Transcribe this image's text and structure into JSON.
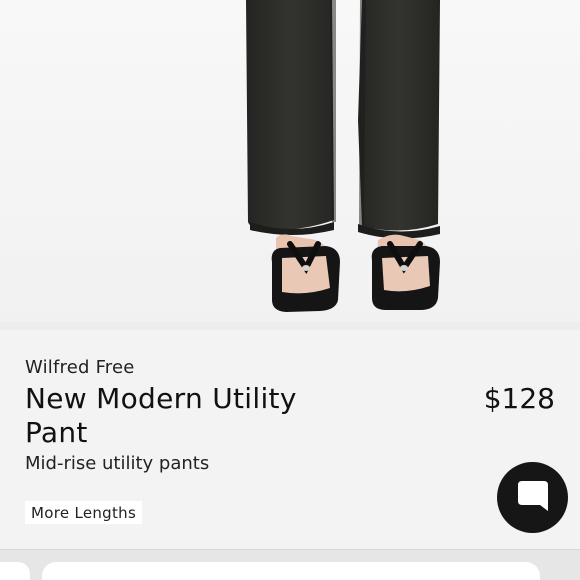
{
  "product": {
    "brand": "Wilfred Free",
    "title": "New Modern Utility Pant",
    "price": "$128",
    "subtitle": "Mid-rise utility pants",
    "lengths_label": "More Lengths"
  },
  "icons": {
    "chat": "chat-bubble-icon"
  },
  "colors": {
    "pants": "#2b2b29",
    "sandals": "#121212",
    "chat_button": "#161616",
    "background": "#f3f3f3"
  }
}
